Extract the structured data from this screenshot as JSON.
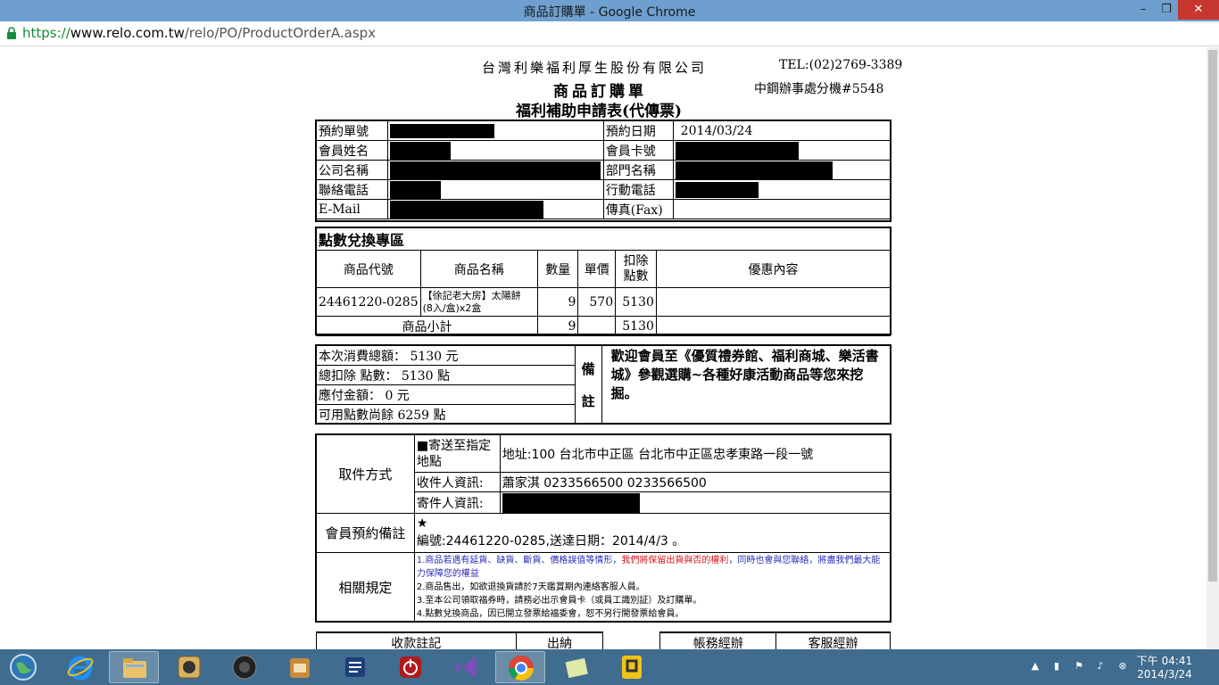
{
  "window": {
    "title": "商品訂購單 - Google Chrome",
    "min_label": "–",
    "max_label": "❐",
    "close_label": "✕"
  },
  "address": {
    "scheme": "https://",
    "host": "www.relo.com.tw",
    "path": "/relo/PO/ProductOrderA.aspx"
  },
  "header": {
    "company": "台灣利樂福利厚生股份有限公司",
    "title": "商品訂購單",
    "subtitle": "福利補助申請表(代傳票)",
    "tel": "TEL:(02)2769-3389",
    "ext": "中鋼辦事處分機#5548"
  },
  "member": {
    "order_no_label": "預約單號",
    "order_date_label": "預約日期",
    "order_date": "2014/03/24",
    "name_label": "會員姓名",
    "card_label": "會員卡號",
    "company_label": "公司名稱",
    "dept_label": "部門名稱",
    "phone_label": "聯絡電話",
    "mobile_label": "行動電話",
    "email_label": "E-Mail",
    "fax_label": "傳真(Fax)"
  },
  "points": {
    "section_title": "點數兌換專區",
    "headers": {
      "code": "商品代號",
      "name": "商品名稱",
      "qty": "數量",
      "price": "單價",
      "points_line1": "扣除",
      "points_line2": "點數",
      "promo": "優惠內容"
    },
    "row": {
      "code": "24461220-0285",
      "name_line1": "【徐記老大房】太陽餅",
      "name_line2": "(8入/盒)x2盒",
      "qty": "9",
      "price": "570",
      "points": "5130",
      "promo": ""
    },
    "subtotal_label": "商品小計",
    "subtotal_qty": "9",
    "subtotal_points": "5130"
  },
  "summary": {
    "total_amount": "本次消費總額： 5130 元",
    "total_points": "總扣除 點數： 5130 點",
    "payable": "應付金額： 0 元",
    "remaining": "可用點數尚餘 6259 點",
    "remark_char1": "備",
    "remark_char2": "註",
    "remark_text": "歡迎會員至《優質禮券館、福利商城、樂活書城》參觀選購~各種好康活動商品等您來挖掘。"
  },
  "pickup": {
    "method_label": "取件方式",
    "delivery_line1": "■寄送至指定",
    "delivery_line2": "地點",
    "address": "地址:100 台北市中正區 台北市中正區忠孝東路一段一號",
    "recipient_label": "收件人資訊:",
    "recipient_value": "蕭家淇 0233566500 0233566500",
    "sender_label": "寄件人資訊:",
    "member_note_label": "會員預約備註",
    "member_note_star": "★",
    "member_note_text": "編號:24461220-0285,送達日期：2014/4/3 。",
    "rules_label": "相關規定",
    "rule1_blue_a": "1.商品若遇有延貨、缺貨、斷貨、價格誤值等情形，",
    "rule1_red": "我們將保留出貨與否的權利",
    "rule1_blue_b": "，同時也會與您聯絡，將盡我們最大能力保障您的權益",
    "rule2": "2.商品售出，如欲退換貨請於7天鑑賞期內連絡客服人員。",
    "rule3": "3.至本公司領取福券時，請務必出示會員卡（或員工識別証）及訂購單。",
    "rule4": "4.點數兌換商品，因已開立發票給福委會，恕不另行開發票給會員。"
  },
  "sign": {
    "receipt": "收款註記",
    "cashier": "出納",
    "accounting": "帳務經辦",
    "service": "客服經辦"
  },
  "taskbar": {
    "time": "下午 04:41",
    "date": "2014/3/24"
  }
}
